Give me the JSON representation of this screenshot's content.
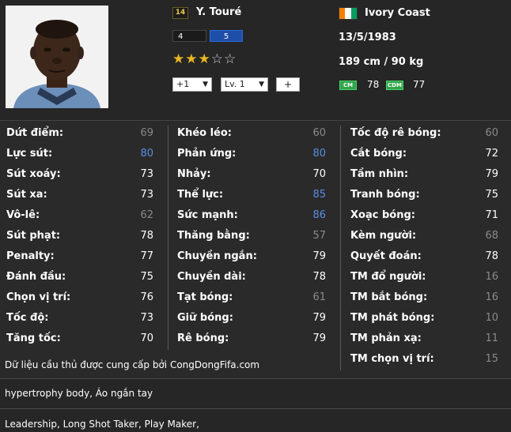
{
  "player": {
    "season_number": "14",
    "name": "Y. Touré",
    "ovr_a": "4",
    "ovr_b": "5",
    "stars_on": "★★★",
    "stars_off": "☆☆",
    "star_rating": 3,
    "star_max": 5,
    "upgrade": "+1",
    "level": "Lv. 1",
    "plus": "+",
    "nation": "Ivory Coast",
    "flag_colors": [
      "#f77f00",
      "#ffffff",
      "#009e60"
    ],
    "dob": "13/5/1983",
    "body": "189 cm / 90 kg",
    "positions": [
      {
        "code": "CM",
        "value": "78"
      },
      {
        "code": "CDM",
        "value": "77"
      }
    ]
  },
  "stats": {
    "col1": [
      {
        "label": "Dứt điểm:",
        "value": "69",
        "color": "gray"
      },
      {
        "label": "Lực sút:",
        "value": "80",
        "color": "blue"
      },
      {
        "label": "Sút xoáy:",
        "value": "73",
        "color": "white"
      },
      {
        "label": "Sút xa:",
        "value": "73",
        "color": "white"
      },
      {
        "label": "Vô-lê:",
        "value": "62",
        "color": "gray"
      },
      {
        "label": "Sút phạt:",
        "value": "78",
        "color": "white"
      },
      {
        "label": "Penalty:",
        "value": "77",
        "color": "white"
      },
      {
        "label": "Đánh đầu:",
        "value": "75",
        "color": "white"
      },
      {
        "label": "Chọn vị trí:",
        "value": "76",
        "color": "white"
      },
      {
        "label": "Tốc độ:",
        "value": "73",
        "color": "white"
      },
      {
        "label": "Tăng tốc:",
        "value": "70",
        "color": "white"
      }
    ],
    "col2": [
      {
        "label": "Khéo léo:",
        "value": "60",
        "color": "gray"
      },
      {
        "label": "Phản ứng:",
        "value": "80",
        "color": "blue"
      },
      {
        "label": "Nhảy:",
        "value": "70",
        "color": "white"
      },
      {
        "label": "Thể lực:",
        "value": "85",
        "color": "blue"
      },
      {
        "label": "Sức mạnh:",
        "value": "86",
        "color": "blue"
      },
      {
        "label": "Thăng bằng:",
        "value": "57",
        "color": "gray"
      },
      {
        "label": "Chuyền ngắn:",
        "value": "79",
        "color": "white"
      },
      {
        "label": "Chuyền dài:",
        "value": "78",
        "color": "white"
      },
      {
        "label": "Tạt bóng:",
        "value": "61",
        "color": "gray"
      },
      {
        "label": "Giữ bóng:",
        "value": "79",
        "color": "white"
      },
      {
        "label": "Rê bóng:",
        "value": "79",
        "color": "white"
      }
    ],
    "col3": [
      {
        "label": "Tốc độ rê bóng:",
        "value": "60",
        "color": "gray"
      },
      {
        "label": "Cắt bóng:",
        "value": "72",
        "color": "white"
      },
      {
        "label": "Tầm nhìn:",
        "value": "79",
        "color": "white"
      },
      {
        "label": "Tranh bóng:",
        "value": "75",
        "color": "white"
      },
      {
        "label": "Xoạc bóng:",
        "value": "71",
        "color": "white"
      },
      {
        "label": "Kèm người:",
        "value": "68",
        "color": "gray"
      },
      {
        "label": "Quyết đoán:",
        "value": "78",
        "color": "white"
      },
      {
        "label": "TM đổ người:",
        "value": "16",
        "color": "gray"
      },
      {
        "label": "TM bắt bóng:",
        "value": "16",
        "color": "gray"
      },
      {
        "label": "TM phát bóng:",
        "value": "10",
        "color": "gray"
      },
      {
        "label": "TM phản xạ:",
        "value": "11",
        "color": "gray"
      },
      {
        "label": "TM chọn vị trí:",
        "value": "15",
        "color": "gray"
      }
    ],
    "credit": "Dữ liệu cầu thủ được cung cấp bởi CongDongFifa.com"
  },
  "traits": "hypertrophy body, Áo ngắn tay",
  "skills": "Leadership, Long Shot Taker, Play Maker,"
}
